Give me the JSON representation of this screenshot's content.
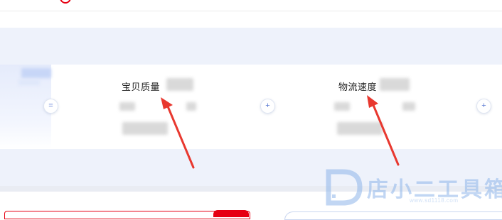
{
  "metrics": [
    {
      "title": "宝贝质量"
    },
    {
      "title": "物流速度"
    }
  ],
  "controls": {
    "collapse_symbol": "=",
    "expand_symbol": "+"
  },
  "watermark": {
    "text": "店小二工具箱",
    "url": "www.sd1118.com"
  },
  "colors": {
    "accent_red": "#e60012",
    "panel_blue": "#eef2fb",
    "arrow_red": "#e8382f",
    "watermark_blue": "#8fb6ea"
  }
}
